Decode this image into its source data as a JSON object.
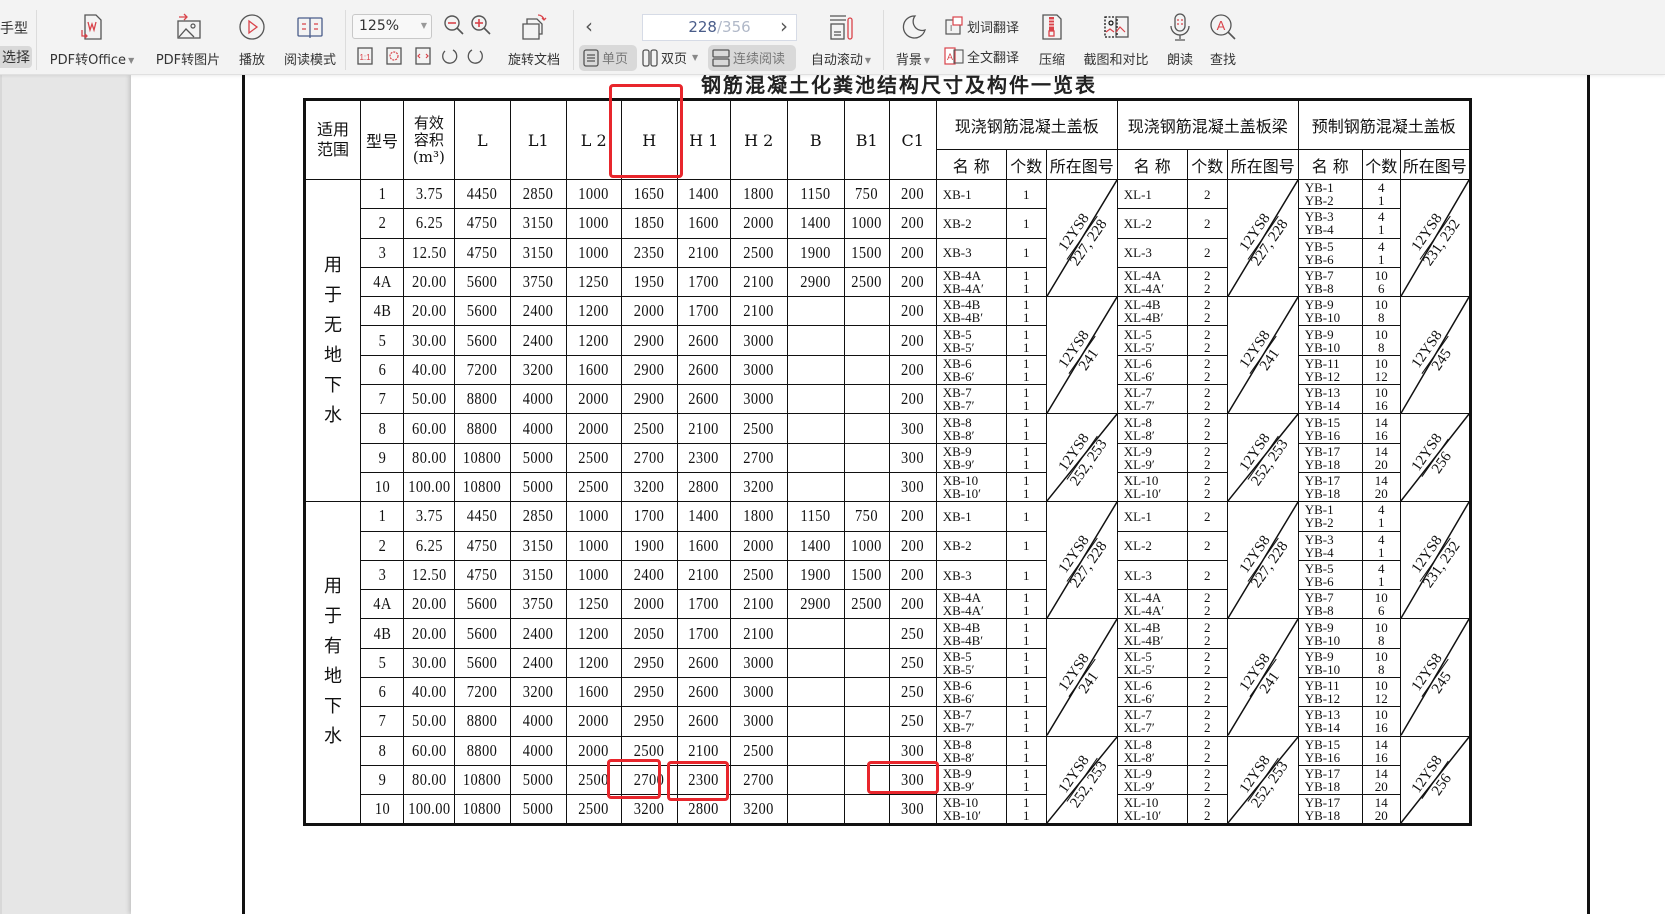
{
  "toolbar": {
    "left_tabs": [
      "手型",
      "选择"
    ],
    "items": [
      {
        "id": "pdf-to-office",
        "label": "PDF转Office",
        "dropdown": true,
        "icon": "pdf-to-word-icon"
      },
      {
        "id": "pdf-to-image",
        "label": "PDF转图片",
        "dropdown": false,
        "icon": "pdf-to-image-icon"
      },
      {
        "id": "play",
        "label": "播放",
        "dropdown": false,
        "icon": "play-icon"
      },
      {
        "id": "read-mode",
        "label": "阅读模式",
        "dropdown": false,
        "icon": "book-icon"
      },
      {
        "id": "rotate-doc",
        "label": "旋转文档",
        "dropdown": false,
        "icon": "rotate-document-icon"
      },
      {
        "id": "auto-scroll",
        "label": "自动滚动",
        "dropdown": true,
        "icon": "auto-scroll-icon"
      },
      {
        "id": "background",
        "label": "背景",
        "dropdown": true,
        "icon": "moon-icon"
      },
      {
        "id": "compress",
        "label": "压缩",
        "dropdown": false,
        "icon": "zip-icon"
      },
      {
        "id": "screenshot-compare",
        "label": "截图和对比",
        "dropdown": false,
        "icon": "screenshot-icon"
      },
      {
        "id": "read-aloud",
        "label": "朗读",
        "dropdown": false,
        "icon": "microphone-icon"
      },
      {
        "id": "find",
        "label": "查找",
        "dropdown": false,
        "icon": "find-icon"
      }
    ],
    "zoom_level": "125%",
    "page_current": "228",
    "page_total": "/356",
    "view_modes": [
      {
        "label": "单页",
        "active": true
      },
      {
        "label": "双页",
        "active": false,
        "dropdown": true
      },
      {
        "label": "连续阅读",
        "active": true
      }
    ],
    "translate_word": "划词翻译",
    "translate_full": "全文翻译"
  },
  "document": {
    "title": "钢筋混凝土化粪池结构尺寸及构件一览表",
    "header": {
      "scope": "适用\n范围",
      "model": "型号",
      "volume": "有效\n容积\n(m³)",
      "dims": [
        "L",
        "L1",
        "L 2",
        "H",
        "H 1",
        "H 2",
        "B",
        "B1",
        "C1"
      ],
      "groups": [
        "现浇钢筋混凝土盖板",
        "现浇钢筋混凝土盖板梁",
        "预制钢筋混凝土盖板"
      ],
      "sub": [
        "名 称",
        "个数",
        "所在图号"
      ]
    },
    "sections": [
      {
        "scope": "用于无地下水",
        "rows": [
          {
            "model": "1",
            "vol": "3.75",
            "L": "4450",
            "L1": "2850",
            "L2": "1000",
            "H": "1650",
            "H1": "1400",
            "H2": "1800",
            "B": "1150",
            "B1": "750",
            "C1": "200",
            "xb": "XB-1",
            "xbn": "1",
            "xl": "XL-1",
            "xln": "2",
            "yb": "YB-1\nYB-2",
            "ybn": "4\n1"
          },
          {
            "model": "2",
            "vol": "6.25",
            "L": "4750",
            "L1": "3150",
            "L2": "1000",
            "H": "1850",
            "H1": "1600",
            "H2": "2000",
            "B": "1400",
            "B1": "1000",
            "C1": "200",
            "xb": "XB-2",
            "xbn": "1",
            "xl": "XL-2",
            "xln": "2",
            "yb": "YB-3\nYB-4",
            "ybn": "4\n1"
          },
          {
            "model": "3",
            "vol": "12.50",
            "L": "4750",
            "L1": "3150",
            "L2": "1000",
            "H": "2350",
            "H1": "2100",
            "H2": "2500",
            "B": "1900",
            "B1": "1500",
            "C1": "200",
            "xb": "XB-3",
            "xbn": "1",
            "xl": "XL-3",
            "xln": "2",
            "yb": "YB-5\nYB-6",
            "ybn": "4\n1"
          },
          {
            "model": "4A",
            "vol": "20.00",
            "L": "5600",
            "L1": "3750",
            "L2": "1250",
            "H": "1950",
            "H1": "1700",
            "H2": "2100",
            "B": "2900",
            "B1": "2500",
            "C1": "200",
            "xb": "XB-4A\nXB-4A′",
            "xbn": "1\n1",
            "xl": "XL-4A\nXL-4A′",
            "xln": "2\n2",
            "yb": "YB-7\nYB-8",
            "ybn": "10\n6"
          },
          {
            "model": "4B",
            "vol": "20.00",
            "L": "5600",
            "L1": "2400",
            "L2": "1200",
            "H": "2000",
            "H1": "1700",
            "H2": "2100",
            "B": "",
            "B1": "",
            "C1": "200",
            "xb": "XB-4B\nXB-4B′",
            "xbn": "1\n1",
            "xl": "XL-4B\nXL-4B′",
            "xln": "2\n2",
            "yb": "YB-9\nYB-10",
            "ybn": "10\n8"
          },
          {
            "model": "5",
            "vol": "30.00",
            "L": "5600",
            "L1": "2400",
            "L2": "1200",
            "H": "2900",
            "H1": "2600",
            "H2": "3000",
            "B": "",
            "B1": "",
            "C1": "200",
            "xb": "XB-5\nXB-5′",
            "xbn": "1\n1",
            "xl": "XL-5\nXL-5′",
            "xln": "2\n2",
            "yb": "YB-9\nYB-10",
            "ybn": "10\n8"
          },
          {
            "model": "6",
            "vol": "40.00",
            "L": "7200",
            "L1": "3200",
            "L2": "1600",
            "H": "2900",
            "H1": "2600",
            "H2": "3000",
            "B": "",
            "B1": "",
            "C1": "200",
            "xb": "XB-6\nXB-6′",
            "xbn": "1\n1",
            "xl": "XL-6\nXL-6′",
            "xln": "2\n2",
            "yb": "YB-11\nYB-12",
            "ybn": "10\n12"
          },
          {
            "model": "7",
            "vol": "50.00",
            "L": "8800",
            "L1": "4000",
            "L2": "2000",
            "H": "2900",
            "H1": "2600",
            "H2": "3000",
            "B": "",
            "B1": "",
            "C1": "200",
            "xb": "XB-7\nXB-7′",
            "xbn": "1\n1",
            "xl": "XL-7\nXL-7′",
            "xln": "2\n2",
            "yb": "YB-13\nYB-14",
            "ybn": "10\n16"
          },
          {
            "model": "8",
            "vol": "60.00",
            "L": "8800",
            "L1": "4000",
            "L2": "2000",
            "H": "2500",
            "H1": "2100",
            "H2": "2500",
            "B": "",
            "B1": "",
            "C1": "300",
            "xb": "XB-8\nXB-8′",
            "xbn": "1\n1",
            "xl": "XL-8\nXL-8′",
            "xln": "2\n2",
            "yb": "YB-15\nYB-16",
            "ybn": "14\n16"
          },
          {
            "model": "9",
            "vol": "80.00",
            "L": "10800",
            "L1": "5000",
            "L2": "2500",
            "H": "2700",
            "H1": "2300",
            "H2": "2700",
            "B": "",
            "B1": "",
            "C1": "300",
            "xb": "XB-9\nXB-9′",
            "xbn": "1\n1",
            "xl": "XL-9\nXL-9′",
            "xln": "2\n2",
            "yb": "YB-17\nYB-18",
            "ybn": "14\n20"
          },
          {
            "model": "10",
            "vol": "100.00",
            "L": "10800",
            "L1": "5000",
            "L2": "2500",
            "H": "3200",
            "H1": "2800",
            "H2": "3200",
            "B": "",
            "B1": "",
            "C1": "300",
            "xb": "XB-10\nXB-10′",
            "xbn": "1\n1",
            "xl": "XL-10\nXL-10′",
            "xln": "2\n2",
            "yb": "YB-17\nYB-18",
            "ybn": "14\n20"
          }
        ],
        "refs": {
          "xb": [
            {
              "top": "12YS8",
              "bottom": "227, 228",
              "span": 4
            },
            {
              "top": "12YS8",
              "bottom": "241",
              "span": 4
            },
            {
              "top": "12YS8",
              "bottom": "252, 253",
              "span": 3
            }
          ],
          "xl": [
            {
              "top": "12YS8",
              "bottom": "227, 228",
              "span": 4
            },
            {
              "top": "12YS8",
              "bottom": "241",
              "span": 4
            },
            {
              "top": "12YS8",
              "bottom": "252, 253",
              "span": 3
            }
          ],
          "yb": [
            {
              "top": "12YS8",
              "bottom": "231, 232",
              "span": 4
            },
            {
              "top": "12YS8",
              "bottom": "245",
              "span": 4
            },
            {
              "top": "12YS8",
              "bottom": "256",
              "span": 3
            }
          ]
        }
      },
      {
        "scope": "用于有地下水",
        "rows": [
          {
            "model": "1",
            "vol": "3.75",
            "L": "4450",
            "L1": "2850",
            "L2": "1000",
            "H": "1700",
            "H1": "1400",
            "H2": "1800",
            "B": "1150",
            "B1": "750",
            "C1": "200",
            "xb": "XB-1",
            "xbn": "1",
            "xl": "XL-1",
            "xln": "2",
            "yb": "YB-1\nYB-2",
            "ybn": "4\n1"
          },
          {
            "model": "2",
            "vol": "6.25",
            "L": "4750",
            "L1": "3150",
            "L2": "1000",
            "H": "1900",
            "H1": "1600",
            "H2": "2000",
            "B": "1400",
            "B1": "1000",
            "C1": "200",
            "xb": "XB-2",
            "xbn": "1",
            "xl": "XL-2",
            "xln": "2",
            "yb": "YB-3\nYB-4",
            "ybn": "4\n1"
          },
          {
            "model": "3",
            "vol": "12.50",
            "L": "4750",
            "L1": "3150",
            "L2": "1000",
            "H": "2400",
            "H1": "2100",
            "H2": "2500",
            "B": "1900",
            "B1": "1500",
            "C1": "200",
            "xb": "XB-3",
            "xbn": "1",
            "xl": "XL-3",
            "xln": "2",
            "yb": "YB-5\nYB-6",
            "ybn": "4\n1"
          },
          {
            "model": "4A",
            "vol": "20.00",
            "L": "5600",
            "L1": "3750",
            "L2": "1250",
            "H": "2000",
            "H1": "1700",
            "H2": "2100",
            "B": "2900",
            "B1": "2500",
            "C1": "200",
            "xb": "XB-4A\nXB-4A′",
            "xbn": "1\n1",
            "xl": "XL-4A\nXL-4A′",
            "xln": "2\n2",
            "yb": "YB-7\nYB-8",
            "ybn": "10\n6"
          },
          {
            "model": "4B",
            "vol": "20.00",
            "L": "5600",
            "L1": "2400",
            "L2": "1200",
            "H": "2050",
            "H1": "1700",
            "H2": "2100",
            "B": "",
            "B1": "",
            "C1": "250",
            "xb": "XB-4B\nXB-4B′",
            "xbn": "1\n1",
            "xl": "XL-4B\nXL-4B′",
            "xln": "2\n2",
            "yb": "YB-9\nYB-10",
            "ybn": "10\n8"
          },
          {
            "model": "5",
            "vol": "30.00",
            "L": "5600",
            "L1": "2400",
            "L2": "1200",
            "H": "2950",
            "H1": "2600",
            "H2": "3000",
            "B": "",
            "B1": "",
            "C1": "250",
            "xb": "XB-5\nXB-5′",
            "xbn": "1\n1",
            "xl": "XL-5\nXL-5′",
            "xln": "2\n2",
            "yb": "YB-9\nYB-10",
            "ybn": "10\n8"
          },
          {
            "model": "6",
            "vol": "40.00",
            "L": "7200",
            "L1": "3200",
            "L2": "1600",
            "H": "2950",
            "H1": "2600",
            "H2": "3000",
            "B": "",
            "B1": "",
            "C1": "250",
            "xb": "XB-6\nXB-6′",
            "xbn": "1\n1",
            "xl": "XL-6\nXL-6′",
            "xln": "2\n2",
            "yb": "YB-11\nYB-12",
            "ybn": "10\n12"
          },
          {
            "model": "7",
            "vol": "50.00",
            "L": "8800",
            "L1": "4000",
            "L2": "2000",
            "H": "2950",
            "H1": "2600",
            "H2": "3000",
            "B": "",
            "B1": "",
            "C1": "250",
            "xb": "XB-7\nXB-7′",
            "xbn": "1\n1",
            "xl": "XL-7\nXL-7′",
            "xln": "2\n2",
            "yb": "YB-13\nYB-14",
            "ybn": "10\n16"
          },
          {
            "model": "8",
            "vol": "60.00",
            "L": "8800",
            "L1": "4000",
            "L2": "2000",
            "H": "2500",
            "H1": "2100",
            "H2": "2500",
            "B": "",
            "B1": "",
            "C1": "300",
            "xb": "XB-8\nXB-8′",
            "xbn": "1\n1",
            "xl": "XL-8\nXL-8′",
            "xln": "2\n2",
            "yb": "YB-15\nYB-16",
            "ybn": "14\n16"
          },
          {
            "model": "9",
            "vol": "80.00",
            "L": "10800",
            "L1": "5000",
            "L2": "2500",
            "H": "2700",
            "H1": "2300",
            "H2": "2700",
            "B": "",
            "B1": "",
            "C1": "300",
            "xb": "XB-9\nXB-9′",
            "xbn": "1\n1",
            "xl": "XL-9\nXL-9′",
            "xln": "2\n2",
            "yb": "YB-17\nYB-18",
            "ybn": "14\n20"
          },
          {
            "model": "10",
            "vol": "100.00",
            "L": "10800",
            "L1": "5000",
            "L2": "2500",
            "H": "3200",
            "H1": "2800",
            "H2": "3200",
            "B": "",
            "B1": "",
            "C1": "300",
            "xb": "XB-10\nXB-10′",
            "xbn": "1\n1",
            "xl": "XL-10\nXL-10′",
            "xln": "2\n2",
            "yb": "YB-17\nYB-18",
            "ybn": "14\n20"
          }
        ],
        "refs": {
          "xb": [
            {
              "top": "12YS8",
              "bottom": "227, 228",
              "span": 4
            },
            {
              "top": "12YS8",
              "bottom": "241",
              "span": 4
            },
            {
              "top": "12YS8",
              "bottom": "252, 253",
              "span": 3
            }
          ],
          "xl": [
            {
              "top": "12YS8",
              "bottom": "227, 228",
              "span": 4
            },
            {
              "top": "12YS8",
              "bottom": "241",
              "span": 4
            },
            {
              "top": "12YS8",
              "bottom": "252, 253",
              "span": 3
            }
          ],
          "yb": [
            {
              "top": "12YS8",
              "bottom": "231, 232",
              "span": 4
            },
            {
              "top": "12YS8",
              "bottom": "245",
              "span": 4
            },
            {
              "top": "12YS8",
              "bottom": "256",
              "span": 3
            }
          ]
        }
      }
    ],
    "highlights": [
      "header H column",
      "有地下水 model 9 H = 2700",
      "有地下水 model 9 H1 = 2300",
      "有地下水 model 9 C1 = 300"
    ],
    "highlight_color": "#e8262c"
  }
}
